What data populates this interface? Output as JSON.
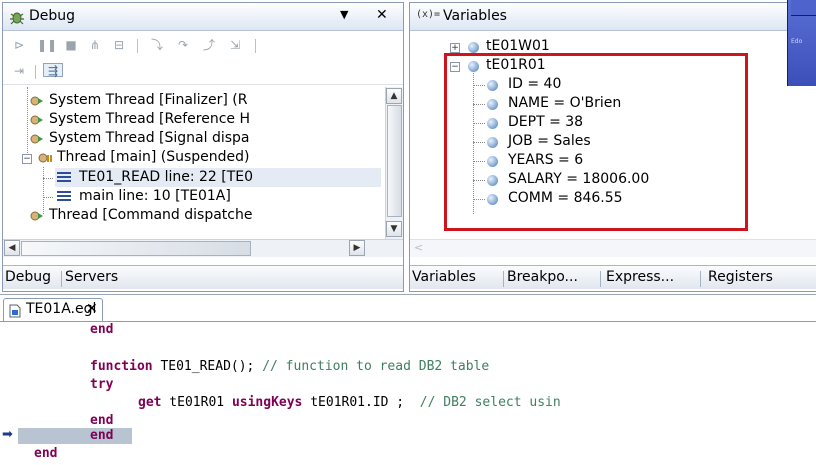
{
  "debug_view": {
    "title": "Debug",
    "tree": [
      {
        "label": "System Thread [Finalizer] (R"
      },
      {
        "label": "System Thread [Reference H"
      },
      {
        "label": "System Thread [Signal dispa"
      },
      {
        "label": "Thread [main] (Suspended)"
      },
      {
        "label": "TE01_READ line: 22 [TE0"
      },
      {
        "label": "main line: 10 [TE01A]"
      },
      {
        "label": "Thread [Command dispatche"
      }
    ],
    "tabs": [
      "Debug",
      "Servers"
    ]
  },
  "variables_view": {
    "title": "Variables",
    "tree": [
      {
        "label": "tE01W01"
      },
      {
        "label": "tE01R01"
      },
      {
        "label": "ID = 40"
      },
      {
        "label": "NAME = O'Brien"
      },
      {
        "label": "DEPT = 38"
      },
      {
        "label": "JOB = Sales"
      },
      {
        "label": "YEARS = 6"
      },
      {
        "label": "SALARY = 18006.00"
      },
      {
        "label": "COMM = 846.55"
      }
    ],
    "tabs": [
      "Variables",
      "Breakpo...",
      "Express...",
      "Registers"
    ]
  },
  "side_widget": {
    "label": "Edo"
  },
  "editor": {
    "tab_label": "TE01A.egl",
    "close_glyph": "✕",
    "lines": {
      "l1_end": "end",
      "l3_kw": "function",
      "l3_name": " TE01_READ(); ",
      "l3_comment": "// function to read DB2 table",
      "l4_kw": "try",
      "l5_kw": "get",
      "l5_mid": " tE01R01 ",
      "l5_kw2": "usingKeys",
      "l5_rest": " tE01R01.ID ;  ",
      "l5_comment": "// DB2 select usin",
      "l6_end": "end",
      "l7_end": "end",
      "l8_end": "end"
    }
  }
}
